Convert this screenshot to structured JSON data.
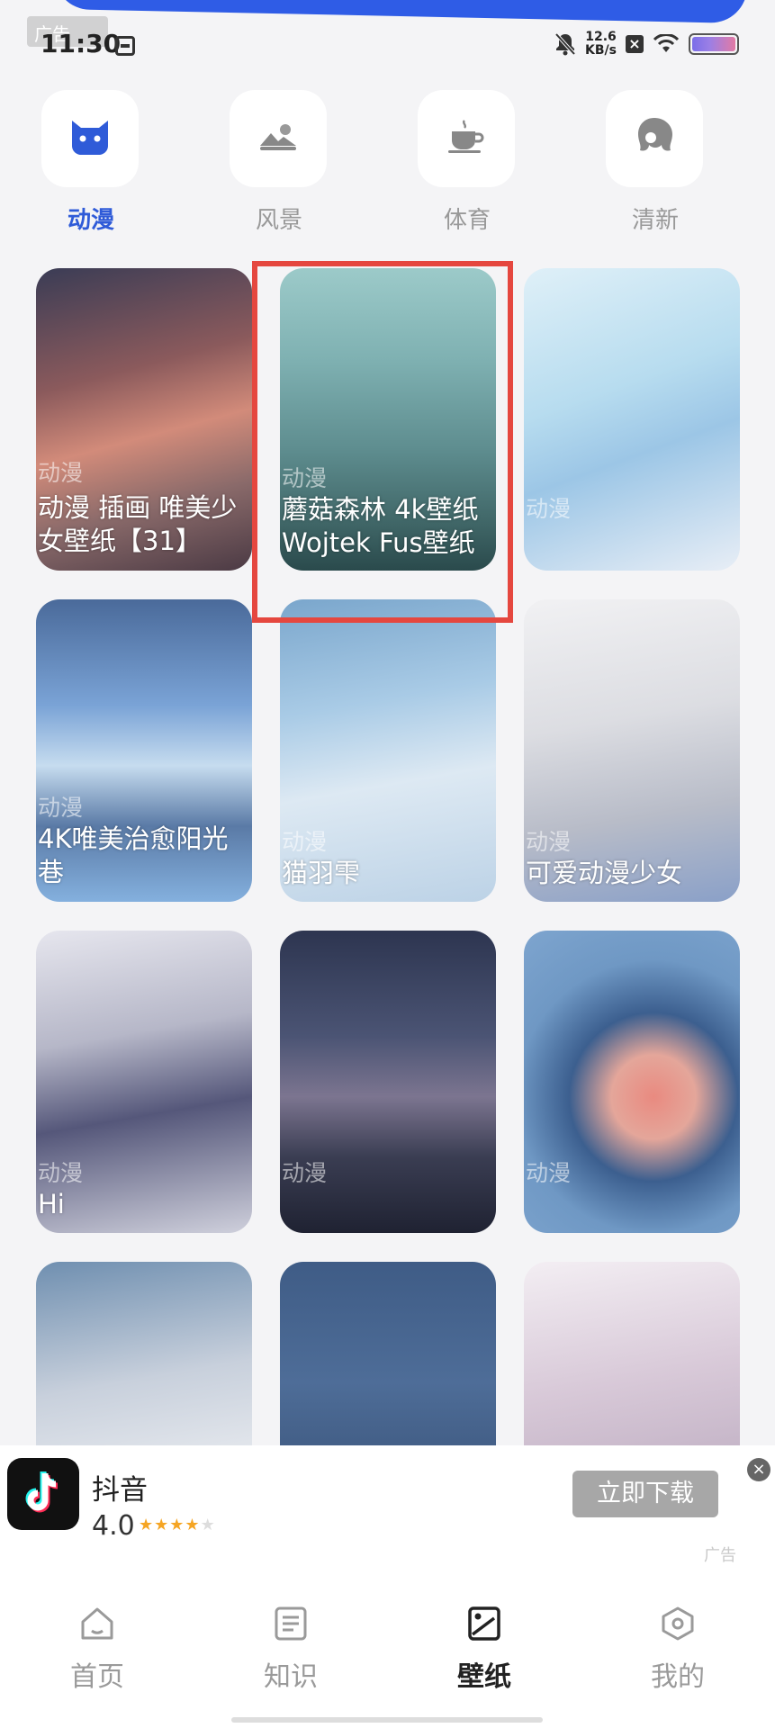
{
  "status_bar": {
    "time": "11:30",
    "net_speed_value": "12.6",
    "net_speed_unit": "KB/s"
  },
  "top_ad_tag": "广告",
  "categories": [
    {
      "label": "动漫",
      "icon": "cat-face-icon",
      "active": true
    },
    {
      "label": "风景",
      "icon": "landscape-icon",
      "active": false
    },
    {
      "label": "体育",
      "icon": "coffee-cup-icon",
      "active": false
    },
    {
      "label": "清新",
      "icon": "girl-head-icon",
      "active": false
    }
  ],
  "wallpapers": [
    {
      "category": "动漫",
      "title": "动漫 插画 唯美少女壁纸【31】"
    },
    {
      "category": "动漫",
      "title": "蘑菇森林 4k壁纸 Wojtek Fus壁纸"
    },
    {
      "category": "动漫",
      "title": ""
    },
    {
      "category": "动漫",
      "title": "4K唯美治愈阳光巷"
    },
    {
      "category": "动漫",
      "title": "猫羽雫"
    },
    {
      "category": "动漫",
      "title": "可爱动漫少女"
    },
    {
      "category": "动漫",
      "title": "Hi"
    },
    {
      "category": "动漫",
      "title": ""
    },
    {
      "category": "动漫",
      "title": ""
    },
    {
      "category": "",
      "title": ""
    },
    {
      "category": "",
      "title": ""
    },
    {
      "category": "",
      "title": ""
    }
  ],
  "ad": {
    "app_name": "抖音",
    "rating": "4.0",
    "rating_stars": 4,
    "download_label": "立即下载",
    "close_symbol": "×",
    "tag": "广告"
  },
  "bottom_nav": [
    {
      "label": "首页",
      "icon": "home-icon",
      "active": false
    },
    {
      "label": "知识",
      "icon": "document-icon",
      "active": false
    },
    {
      "label": "壁纸",
      "icon": "wallpaper-icon",
      "active": true
    },
    {
      "label": "我的",
      "icon": "hexagon-icon",
      "active": false
    }
  ],
  "colors": {
    "accent": "#2f5bd8",
    "highlight_box": "#e5473f",
    "inactive_text": "#999999"
  }
}
